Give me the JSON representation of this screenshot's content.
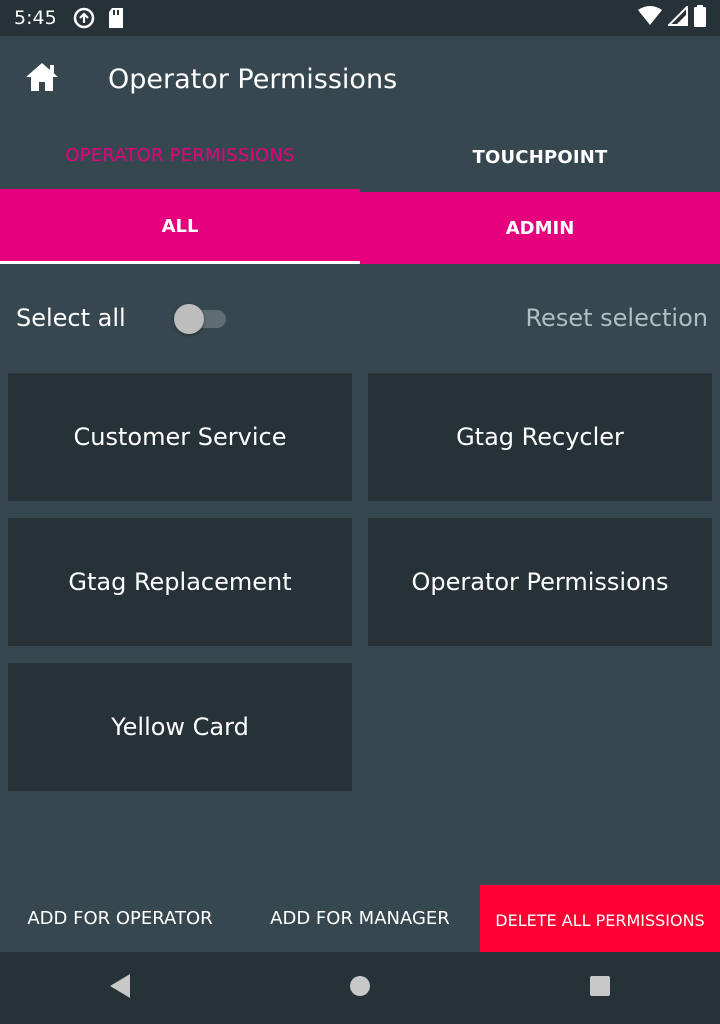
{
  "status_bar": {
    "time": "5:45",
    "left_icons": [
      "sync-icon",
      "sd-card-icon"
    ],
    "right_icons": [
      "wifi-icon",
      "signal-icon",
      "battery-icon"
    ]
  },
  "app_bar": {
    "home_icon": "home-icon",
    "title": "Operator Permissions"
  },
  "primary_tabs": [
    {
      "label": "OPERATOR PERMISSIONS",
      "active": true
    },
    {
      "label": "TOUCHPOINT",
      "active": false
    }
  ],
  "secondary_tabs": [
    {
      "label": "ALL",
      "active": true
    },
    {
      "label": "ADMIN",
      "active": false
    }
  ],
  "selection": {
    "select_all_label": "Select all",
    "select_all_on": false,
    "reset_label": "Reset selection"
  },
  "permissions": [
    "Customer Service",
    "Gtag Recycler",
    "Gtag Replacement",
    "Operator Permissions",
    "Yellow Card"
  ],
  "actions": {
    "add_operator": "ADD FOR OPERATOR",
    "add_manager": "ADD FOR MANAGER",
    "delete_all": "DELETE ALL PERMISSIONS"
  },
  "nav_bar": [
    "back-icon",
    "home-circle-icon",
    "recents-icon"
  ],
  "colors": {
    "accent": "#e6007e",
    "danger": "#ff0033",
    "background": "#37474f",
    "card": "#263238"
  }
}
